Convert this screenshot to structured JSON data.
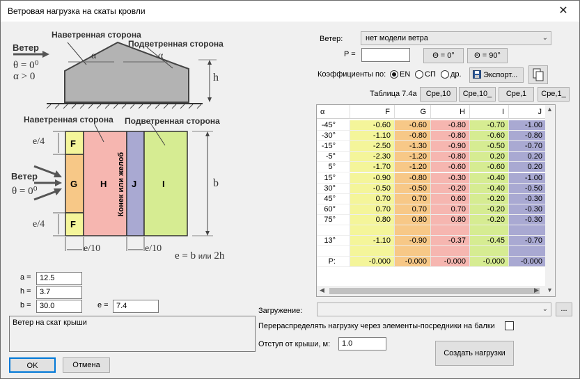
{
  "window": {
    "title": "Ветровая нагрузка на скаты кровли",
    "close_glyph": "✕"
  },
  "diagram": {
    "top": {
      "windward": "Наветренная сторона",
      "leeward": "Подветренная сторона",
      "wind": "Ветер",
      "theta": "θ = 0⁰",
      "alpha_cond": "α > 0",
      "alpha": "α",
      "h": "h"
    },
    "plan": {
      "windward": "Наветренная сторона",
      "leeward": "Подветренная сторона",
      "wind": "Ветер",
      "theta": "θ = 0⁰",
      "e4_top": "e/4",
      "e4_bottom": "e/4",
      "b": "b",
      "e10_left": "e/10",
      "e10_right": "e/10",
      "e_eq": "e = b",
      "e_or": "или",
      "e_2h": "2h",
      "zone_F_top": "F",
      "zone_G": "G",
      "zone_H": "H",
      "zone_ridge": "Конек или желоб",
      "zone_J": "J",
      "zone_I": "I",
      "zone_F_bottom": "F"
    }
  },
  "params": {
    "a_label": "a =",
    "a_value": "12.5",
    "h_label": "h =",
    "h_value": "3.7",
    "b_label": "b =",
    "b_value": "30.0",
    "e_label": "e =",
    "e_value": "7.4"
  },
  "comment": "Ветер на скат крыши",
  "buttons": {
    "ok": "OK",
    "cancel": "Отмена",
    "create": "Создать нагрузки",
    "more": "..."
  },
  "wind": {
    "label": "Ветер:",
    "model": "нет модели ветра",
    "p_label": "P =",
    "p_value": "",
    "theta0": "Θ = 0°",
    "theta90": "Θ = 90°"
  },
  "coef": {
    "label": "Коэффициенты по:",
    "options": [
      "EN",
      "СП",
      "др."
    ],
    "selected": "EN",
    "export": "Экспорт..."
  },
  "table_label": "Таблица 7.4а",
  "cpe_tabs": [
    "Cpe,10",
    "Cpe,10_",
    "Cpe,1",
    "Cpe,1_"
  ],
  "grid": {
    "columns": [
      "α",
      "F",
      "G",
      "H",
      "I",
      "J"
    ],
    "col_colors": [
      "#ffffff",
      "#f4f59a",
      "#f7c887",
      "#f6b6b0",
      "#d6ec92",
      "#a9a9d2"
    ],
    "rows": [
      [
        "-45°",
        "-0.60",
        "-0.60",
        "-0.80",
        "-0.70",
        "-1.00"
      ],
      [
        "-30°",
        "-1.10",
        "-0.80",
        "-0.80",
        "-0.60",
        "-0.80"
      ],
      [
        "-15°",
        "-2.50",
        "-1.30",
        "-0.90",
        "-0.50",
        "-0.70"
      ],
      [
        "-5°",
        "-2.30",
        "-1.20",
        "-0.80",
        "0.20",
        "0.20"
      ],
      [
        "5°",
        "-1.70",
        "-1.20",
        "-0.60",
        "-0.60",
        "0.20"
      ],
      [
        "15°",
        "-0.90",
        "-0.80",
        "-0.30",
        "-0.40",
        "-1.00"
      ],
      [
        "30°",
        "-0.50",
        "-0.50",
        "-0.20",
        "-0.40",
        "-0.50"
      ],
      [
        "45°",
        "0.70",
        "0.70",
        "0.60",
        "-0.20",
        "-0.30"
      ],
      [
        "60°",
        "0.70",
        "0.70",
        "0.70",
        "-0.20",
        "-0.30"
      ],
      [
        "75°",
        "0.80",
        "0.80",
        "0.80",
        "-0.20",
        "-0.30"
      ],
      [
        "",
        "",
        "",
        "",
        "",
        ""
      ],
      [
        "13°",
        "-1.10",
        "-0.90",
        "-0.37",
        "-0.45",
        "-0.70"
      ],
      [
        "",
        "",
        "",
        "",
        "",
        ""
      ],
      [
        "P:",
        "-0.000",
        "-0.000",
        "-0.000",
        "-0.000",
        "-0.000"
      ]
    ]
  },
  "loading": {
    "label": "Загружение:",
    "value": ""
  },
  "redistribute": {
    "label": "Перераспределять нагрузку через элементы-посредники на балки",
    "checked": false
  },
  "offset": {
    "label": "Отступ от крыши, м:",
    "value": "1.0"
  }
}
